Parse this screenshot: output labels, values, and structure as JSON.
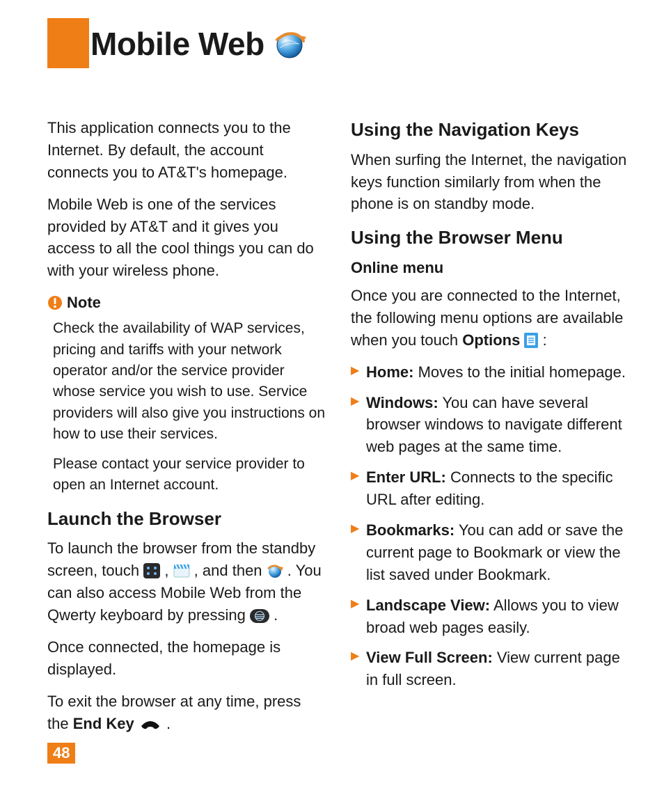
{
  "title": "Mobile Web",
  "page_number": "48",
  "colors": {
    "accent": "#ef7e17"
  },
  "intro": {
    "p1": "This application connects you to the Internet. By default, the account connects you to AT&T's homepage.",
    "p2": "Mobile Web is one of the services provided by AT&T and it gives you access to all the cool things you can do with your wireless phone."
  },
  "note": {
    "heading": "Note",
    "p1": "Check the availability of WAP services, pricing and tariffs with your network operator and/or the service provider whose service you wish to use. Service providers will also give you instructions on how to use their services.",
    "p2": "Please contact your service provider to open an Internet account."
  },
  "launch": {
    "heading": "Launch the Browser",
    "p1a": "To launch the browser from the standby screen, touch ",
    "p1b": ", ",
    "p1c": ", and then ",
    "p1d": ". You can also access Mobile Web from the Qwerty keyboard by pressing ",
    "p1e": ".",
    "p2": "Once connected, the homepage is displayed.",
    "p3a": "To exit the browser at any time, press the ",
    "p3b": "End Key",
    "p3c": " ",
    "p3d": "."
  },
  "nav": {
    "heading": "Using the Navigation Keys",
    "p1": "When surfing the Internet, the navigation keys function similarly from when the phone is on standby mode."
  },
  "menu": {
    "heading": "Using the Browser Menu",
    "sub": "Online menu",
    "intro_a": "Once you are connected to the Internet, the following menu options are available when you touch ",
    "intro_b": "Options",
    "intro_c": " ",
    "intro_d": ":",
    "items": [
      {
        "term": "Home:",
        "desc": " Moves to the initial homepage."
      },
      {
        "term": "Windows:",
        "desc": " You can have several browser windows to navigate different web pages at the same time."
      },
      {
        "term": "Enter URL:",
        "desc": " Connects to the specific URL after editing."
      },
      {
        "term": "Bookmarks:",
        "desc": " You can add or save the current page to Bookmark or view the list saved under Bookmark."
      },
      {
        "term": "Landscape View:",
        "desc": " Allows you to view broad web pages easily."
      },
      {
        "term": "View Full Screen:",
        "desc": " View current page in full screen."
      }
    ]
  }
}
